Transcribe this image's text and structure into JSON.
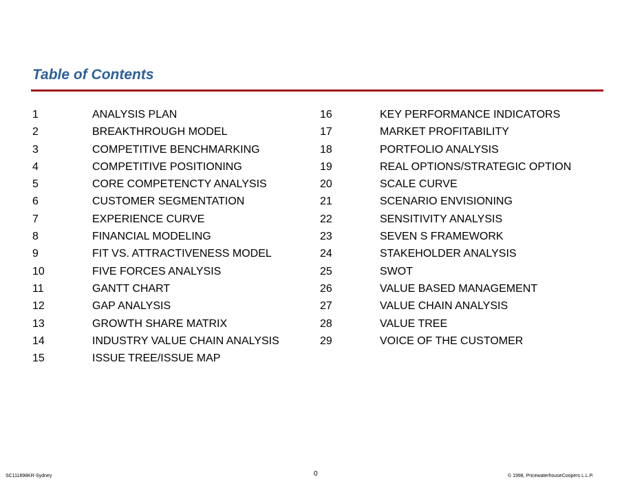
{
  "page": {
    "title": "Table of Contents",
    "accent_color": "#2e5f98",
    "rule_color": "#a3161d"
  },
  "toc": {
    "left": [
      {
        "number": "1",
        "label": "ANALYSIS PLAN"
      },
      {
        "number": "2",
        "label": "BREAKTHROUGH MODEL"
      },
      {
        "number": "3",
        "label": "COMPETITIVE BENCHMARKING"
      },
      {
        "number": "4",
        "label": "COMPETITIVE POSITIONING"
      },
      {
        "number": "5",
        "label": "CORE COMPETENCTY ANALYSIS"
      },
      {
        "number": "6",
        "label": "CUSTOMER SEGMENTATION"
      },
      {
        "number": "7",
        "label": "EXPERIENCE CURVE"
      },
      {
        "number": "8",
        "label": "FINANCIAL MODELING"
      },
      {
        "number": "9",
        "label": "FIT VS. ATTRACTIVENESS MODEL"
      },
      {
        "number": "10",
        "label": "FIVE FORCES ANALYSIS"
      },
      {
        "number": "11",
        "label": "GANTT CHART"
      },
      {
        "number": "12",
        "label": "GAP ANALYSIS"
      },
      {
        "number": "13",
        "label": "GROWTH SHARE MATRIX"
      },
      {
        "number": "14",
        "label": "INDUSTRY VALUE CHAIN ANALYSIS"
      },
      {
        "number": "15",
        "label": "ISSUE TREE/ISSUE MAP"
      }
    ],
    "right": [
      {
        "number": "16",
        "label": "KEY PERFORMANCE INDICATORS"
      },
      {
        "number": "17",
        "label": "MARKET PROFITABILITY"
      },
      {
        "number": "18",
        "label": "PORTFOLIO ANALYSIS"
      },
      {
        "number": "19",
        "label": "REAL OPTIONS/STRATEGIC OPTION"
      },
      {
        "number": "20",
        "label": "SCALE CURVE"
      },
      {
        "number": "21",
        "label": "SCENARIO ENVISIONING"
      },
      {
        "number": "22",
        "label": "SENSITIVITY ANALYSIS"
      },
      {
        "number": "23",
        "label": "SEVEN S FRAMEWORK"
      },
      {
        "number": "24",
        "label": "STAKEHOLDER ANALYSIS"
      },
      {
        "number": "25",
        "label": "SWOT"
      },
      {
        "number": "26",
        "label": "VALUE BASED MANAGEMENT"
      },
      {
        "number": "27",
        "label": "VALUE CHAIN ANALYSIS"
      },
      {
        "number": "28",
        "label": "VALUE TREE"
      },
      {
        "number": "29",
        "label": "VOICE OF THE CUSTOMER"
      }
    ]
  },
  "footer": {
    "doc_id": "SC111898KR-Sydney",
    "page_number": "0",
    "copyright": "© 1998, PricewaterhouseCoopers L.L.P."
  }
}
